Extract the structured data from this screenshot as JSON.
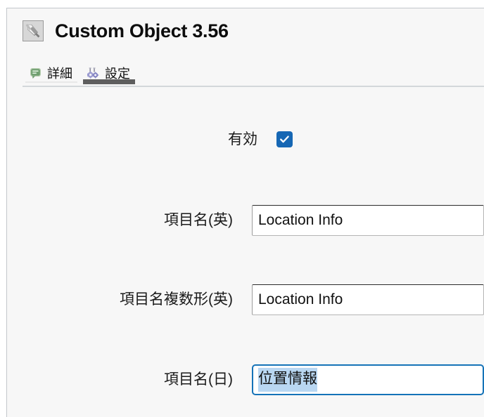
{
  "window": {
    "title": "Custom Object 3.56",
    "object_icon": "plug-connector-icon"
  },
  "tabs": [
    {
      "label": "詳細",
      "icon": "speech-bubble-icon",
      "active": false
    },
    {
      "label": "設定",
      "icon": "gears-icon",
      "active": true
    }
  ],
  "form": {
    "fields": [
      {
        "label": "有効",
        "type": "checkbox",
        "checked": true,
        "icon": "check-icon"
      },
      {
        "label": "項目名(英)",
        "type": "text",
        "value": "Location Info",
        "placeholder": "",
        "focused": false
      },
      {
        "label": "項目名複数形(英)",
        "type": "text",
        "value": "Location Info",
        "placeholder": "",
        "focused": false
      },
      {
        "label": "項目名(日)",
        "type": "text",
        "value": "位置情報",
        "placeholder": "",
        "focused": true,
        "selected": true
      }
    ]
  },
  "colors": {
    "checkbox_blue": "#1667b4",
    "focus_border_blue": "#1573b8",
    "selection_blue": "#b9d7f2",
    "active_tab_underline": "#5e5e5e",
    "panel_background": "#f7f7f7",
    "panel_border": "#c3c7cb",
    "tab_baseline": "#d3d7da",
    "detail_tab_icon_green": "#6f9e6f",
    "settings_tab_icon_purple": "#9a9ad0"
  }
}
